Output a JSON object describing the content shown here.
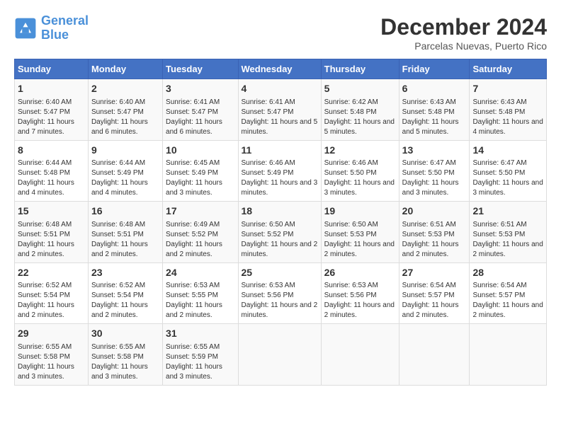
{
  "logo": {
    "line1": "General",
    "line2": "Blue"
  },
  "title": "December 2024",
  "location": "Parcelas Nuevas, Puerto Rico",
  "days_of_week": [
    "Sunday",
    "Monday",
    "Tuesday",
    "Wednesday",
    "Thursday",
    "Friday",
    "Saturday"
  ],
  "weeks": [
    [
      {
        "num": "1",
        "sunrise": "6:40 AM",
        "sunset": "5:47 PM",
        "daylight": "11 hours and 7 minutes."
      },
      {
        "num": "2",
        "sunrise": "6:40 AM",
        "sunset": "5:47 PM",
        "daylight": "11 hours and 6 minutes."
      },
      {
        "num": "3",
        "sunrise": "6:41 AM",
        "sunset": "5:47 PM",
        "daylight": "11 hours and 6 minutes."
      },
      {
        "num": "4",
        "sunrise": "6:41 AM",
        "sunset": "5:47 PM",
        "daylight": "11 hours and 5 minutes."
      },
      {
        "num": "5",
        "sunrise": "6:42 AM",
        "sunset": "5:48 PM",
        "daylight": "11 hours and 5 minutes."
      },
      {
        "num": "6",
        "sunrise": "6:43 AM",
        "sunset": "5:48 PM",
        "daylight": "11 hours and 5 minutes."
      },
      {
        "num": "7",
        "sunrise": "6:43 AM",
        "sunset": "5:48 PM",
        "daylight": "11 hours and 4 minutes."
      }
    ],
    [
      {
        "num": "8",
        "sunrise": "6:44 AM",
        "sunset": "5:48 PM",
        "daylight": "11 hours and 4 minutes."
      },
      {
        "num": "9",
        "sunrise": "6:44 AM",
        "sunset": "5:49 PM",
        "daylight": "11 hours and 4 minutes."
      },
      {
        "num": "10",
        "sunrise": "6:45 AM",
        "sunset": "5:49 PM",
        "daylight": "11 hours and 3 minutes."
      },
      {
        "num": "11",
        "sunrise": "6:46 AM",
        "sunset": "5:49 PM",
        "daylight": "11 hours and 3 minutes."
      },
      {
        "num": "12",
        "sunrise": "6:46 AM",
        "sunset": "5:50 PM",
        "daylight": "11 hours and 3 minutes."
      },
      {
        "num": "13",
        "sunrise": "6:47 AM",
        "sunset": "5:50 PM",
        "daylight": "11 hours and 3 minutes."
      },
      {
        "num": "14",
        "sunrise": "6:47 AM",
        "sunset": "5:50 PM",
        "daylight": "11 hours and 3 minutes."
      }
    ],
    [
      {
        "num": "15",
        "sunrise": "6:48 AM",
        "sunset": "5:51 PM",
        "daylight": "11 hours and 2 minutes."
      },
      {
        "num": "16",
        "sunrise": "6:48 AM",
        "sunset": "5:51 PM",
        "daylight": "11 hours and 2 minutes."
      },
      {
        "num": "17",
        "sunrise": "6:49 AM",
        "sunset": "5:52 PM",
        "daylight": "11 hours and 2 minutes."
      },
      {
        "num": "18",
        "sunrise": "6:50 AM",
        "sunset": "5:52 PM",
        "daylight": "11 hours and 2 minutes."
      },
      {
        "num": "19",
        "sunrise": "6:50 AM",
        "sunset": "5:53 PM",
        "daylight": "11 hours and 2 minutes."
      },
      {
        "num": "20",
        "sunrise": "6:51 AM",
        "sunset": "5:53 PM",
        "daylight": "11 hours and 2 minutes."
      },
      {
        "num": "21",
        "sunrise": "6:51 AM",
        "sunset": "5:53 PM",
        "daylight": "11 hours and 2 minutes."
      }
    ],
    [
      {
        "num": "22",
        "sunrise": "6:52 AM",
        "sunset": "5:54 PM",
        "daylight": "11 hours and 2 minutes."
      },
      {
        "num": "23",
        "sunrise": "6:52 AM",
        "sunset": "5:54 PM",
        "daylight": "11 hours and 2 minutes."
      },
      {
        "num": "24",
        "sunrise": "6:53 AM",
        "sunset": "5:55 PM",
        "daylight": "11 hours and 2 minutes."
      },
      {
        "num": "25",
        "sunrise": "6:53 AM",
        "sunset": "5:56 PM",
        "daylight": "11 hours and 2 minutes."
      },
      {
        "num": "26",
        "sunrise": "6:53 AM",
        "sunset": "5:56 PM",
        "daylight": "11 hours and 2 minutes."
      },
      {
        "num": "27",
        "sunrise": "6:54 AM",
        "sunset": "5:57 PM",
        "daylight": "11 hours and 2 minutes."
      },
      {
        "num": "28",
        "sunrise": "6:54 AM",
        "sunset": "5:57 PM",
        "daylight": "11 hours and 2 minutes."
      }
    ],
    [
      {
        "num": "29",
        "sunrise": "6:55 AM",
        "sunset": "5:58 PM",
        "daylight": "11 hours and 3 minutes."
      },
      {
        "num": "30",
        "sunrise": "6:55 AM",
        "sunset": "5:58 PM",
        "daylight": "11 hours and 3 minutes."
      },
      {
        "num": "31",
        "sunrise": "6:55 AM",
        "sunset": "5:59 PM",
        "daylight": "11 hours and 3 minutes."
      },
      null,
      null,
      null,
      null
    ]
  ]
}
